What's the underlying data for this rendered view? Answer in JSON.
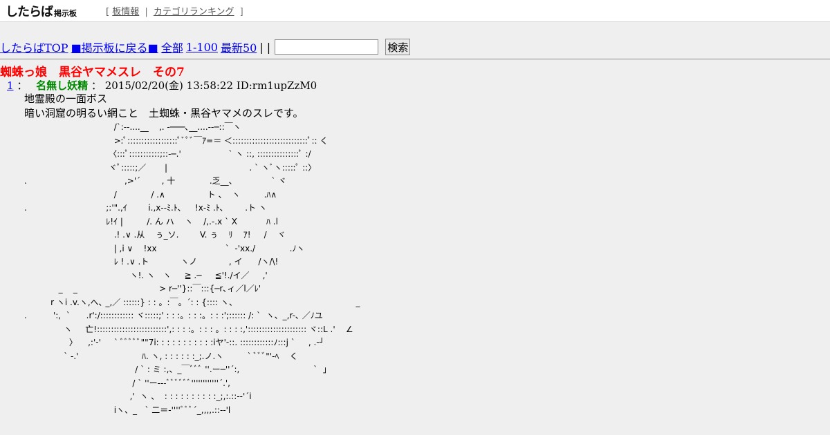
{
  "header": {
    "logo_main": "したらば",
    "logo_sub": "掲示板",
    "bracket_open": "[",
    "link_board_info": "板情報",
    "separator": "|",
    "link_category_ranking": "カテゴリランキング",
    "bracket_close": "]"
  },
  "nav": {
    "top": "したらばTOP",
    "back": "■掲示板に戻る■",
    "all": "全部",
    "range": "1-100",
    "latest": "最新50",
    "sep": "| |",
    "search_value": "",
    "search_button": "検索"
  },
  "thread": {
    "title": "蜘蛛っ娘　黒谷ヤマメスレ　その7"
  },
  "post": {
    "number": "1",
    "colon1": "：",
    "name": "名無し妖精",
    "colon2": "：",
    "date": "2015/02/20(金) 13:58:22",
    "id": "ID:rm1upZzM0",
    "line1": "地霊殿の一面ボス",
    "line2": "暗い洞窟の明るい網こと　土蜘蛛・黒谷ヤマメのスレです。",
    "aa": "                                  /`:-‐....__    ,. -───､__....--─::￣ヽ\n                                  >:ﾟ::::::::::::::::::ﾟﾞﾟﾞ￣ｱ=＝ ＜:::::::::::::::::::::::::::ﾟ:: く\n                                〈:::ﾟ:::::::::::;::-─.'                  ` ヽ ::, :::::::::::::::ﾟ :/\n                                ヾﾟ:::::;／       |                               . ` ヽﾞヽ:::::ﾟ ::〉\n.                                     ,>'´        , 十             .乏__、             ` ヾ\n                                  /             / .∧                ト 、  ヽ         .ﾊ∧\n.                              ;:'\".,ｲ        i.,x--ﾐ.ﾄ､     !x-ﾐ .ﾄ､        .ト ヽ\n                               ﾚ!ｲ |         /. ん ハ    ヽ    /,.-.x ` X           ﾊ .l\n                                  .! .∨ .从    ぅ_ソ.        V. ぅ    ﾘ    ｱ!     /    ヾ\n                                  | ,i ∨    !xx                          `  -'xx./             .ﾉヽ\n                                  ﾚ ! .∨ .ト            ヽノ            , イ      /ヽ/\\!\n                                        ヽ!. ヽ   ヽ     ≧ .─     ≦'!./イ／     ,'\n             _    _                               > r─''}::￣:::{─r､ィ／l／ﾚ'\n          r ヽi .v.ヽ,へ､ _,／ ::::::} : : 。:￣。´: : {:::: ヽ、                                             _\n.          ':,  `      .r':/:::::::::::: ヾ:::::;' : : :。: : :。: : :';:::::: /: `  ヽ、_,r-､ ／ﾉユ\n               ヽ     亡!:::::::::::::::::::::::::',: : : :。: : : 。: : : :,'::::::::::::::::::::: ヾ::L .'    ∠\n                 〉    ,:'-'     ` ﾞﾞﾞﾞﾞ\"\"7i: : : : : : : : : : :iヤ'-::. ::::::::::::ﾉ:::j `     , .-┘\n               ` -.'                        ﾊ. ヽ, : : : : : :_;.ノ.ヽ         ` ﾞﾞﾞ\"'-ﾍ    く\n                                          / ` : ミ :,、_￣ﾞﾞﾞ ''.ー─''´:,                            `  」\n                                         / ` ''ー---ﾞﾞﾞﾞﾞﾞ''''''''''''´.',\n                                        ,'  ヽ 、  : : : : : : : : : :_;,:.::-‐'´i\n                                  iヽ、_   ` 二＝-''''ﾞﾞﾞ´_,,,,.::--'l"
  }
}
